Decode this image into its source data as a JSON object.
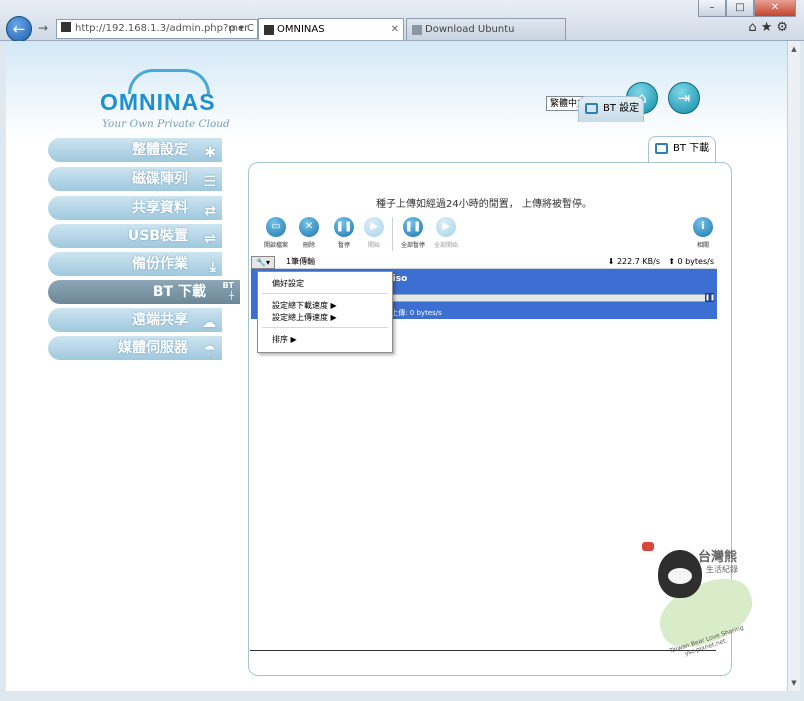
{
  "browser": {
    "url": "http://192.168.1.3/admin.php?mer",
    "url_controls": "ρ ▾ C",
    "tabs": [
      {
        "label": "OMNINAS",
        "active": true
      },
      {
        "label": "Download Ubuntu",
        "active": false
      }
    ],
    "tab_close": "✕",
    "window_controls": {
      "minimize": "–",
      "maximize": "□",
      "close": "✕"
    }
  },
  "brand": {
    "name": "OMNINAS",
    "tagline": "Your Own Private Cloud"
  },
  "language": {
    "selected": "繁體中文"
  },
  "sidebar": {
    "items": [
      {
        "label": "整體設定",
        "icon": "wrench-screwdriver-icon"
      },
      {
        "label": "磁碟陣列",
        "icon": "disk-stack-icon"
      },
      {
        "label": "共享資料",
        "icon": "share-arrows-icon"
      },
      {
        "label": "USB裝置",
        "icon": "usb-icon"
      },
      {
        "label": "備份作業",
        "icon": "backup-icon"
      },
      {
        "label": "BT 下載",
        "icon": "bt-icon",
        "active": true
      },
      {
        "label": "遠端共享",
        "icon": "cloud-share-icon"
      },
      {
        "label": "媒體伺服器",
        "icon": "media-server-icon"
      }
    ],
    "bt_badge": "BT"
  },
  "panel": {
    "tabs": [
      {
        "label": "BT 設定"
      },
      {
        "label": "BT 下載",
        "active": true
      }
    ],
    "notice": "種子上傳如經過24小時的閒置， 上傳將被暫停。",
    "toolbar": [
      {
        "label": "開啟檔案",
        "enabled": true
      },
      {
        "label": "刪除",
        "enabled": true
      },
      {
        "label": "暫停",
        "enabled": true
      },
      {
        "label": "開始",
        "enabled": false
      },
      {
        "label": "全部暫停",
        "enabled": true
      },
      {
        "label": "全部開始",
        "enabled": false
      },
      {
        "label": "相關",
        "enabled": true
      }
    ],
    "status": {
      "count": "1筆傳輸",
      "download_rate": "⬇ 222.7 KB/s",
      "upload_rate": "⬆ 0 bytes/s"
    },
    "transfer": {
      "name_fragment": "4.iso",
      "rate_fragment": "/s 上傳: 0 bytes/s"
    },
    "context_menu": {
      "items": [
        "偏好設定",
        "設定總下載速度 ▶",
        "設定總上傳速度 ▶",
        "排序 ▶"
      ]
    }
  },
  "watermark": {
    "title": "台灣熊",
    "subtitle": "生活紀錄",
    "footer_line1": "Taiwan Bear Love Sharing",
    "footer_line2": "ysc.pixnet.net"
  },
  "colors": {
    "accent": "#1f8fd0",
    "menu_active": "#6c8797",
    "selection": "#3c6fd1"
  }
}
